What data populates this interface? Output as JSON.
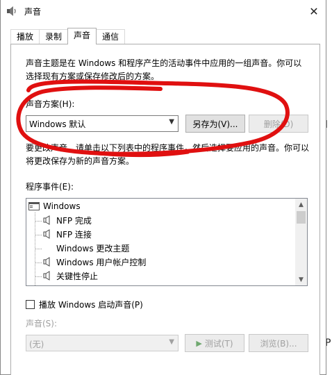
{
  "window": {
    "title": "声音",
    "close_glyph": "✕"
  },
  "tabs": [
    {
      "label": "播放"
    },
    {
      "label": "录制"
    },
    {
      "label": "声音",
      "active": true
    },
    {
      "label": "通信"
    }
  ],
  "description": "声音主题是在 Windows 和程序产生的活动事件中应用的一组声音。你可以选择现有方案或保存修改后的方案。",
  "scheme": {
    "label": "声音方案(H):",
    "selected": "Windows 默认",
    "save_as_label": "另存为(V)...",
    "delete_label": "删除(D)"
  },
  "description2": "要更改声音，请单击以下列表中的程序事件，然后选择要应用的声音。你可以将更改保存为新的声音方案。",
  "events": {
    "label": "程序事件(E):",
    "items": [
      {
        "label": "Windows",
        "type": "group"
      },
      {
        "label": "NFP 完成",
        "type": "sound"
      },
      {
        "label": "NFP 连接",
        "type": "sound"
      },
      {
        "label": "Windows 更改主题",
        "type": "none"
      },
      {
        "label": "Windows 用户帐户控制",
        "type": "sound"
      },
      {
        "label": "关键性停止",
        "type": "sound"
      }
    ]
  },
  "startup_sound": {
    "label": "播放 Windows 启动声音(P)",
    "checked": false
  },
  "sound": {
    "label": "声音(S):",
    "selected": "(无)",
    "test_label": "测试(T)",
    "browse_label": "浏览(B)..."
  },
  "background_fragments": {
    "top": "l",
    "bottom": "P"
  },
  "colors": {
    "annotation_red": "#e01010",
    "disabled_text": "#a0a0a0"
  }
}
